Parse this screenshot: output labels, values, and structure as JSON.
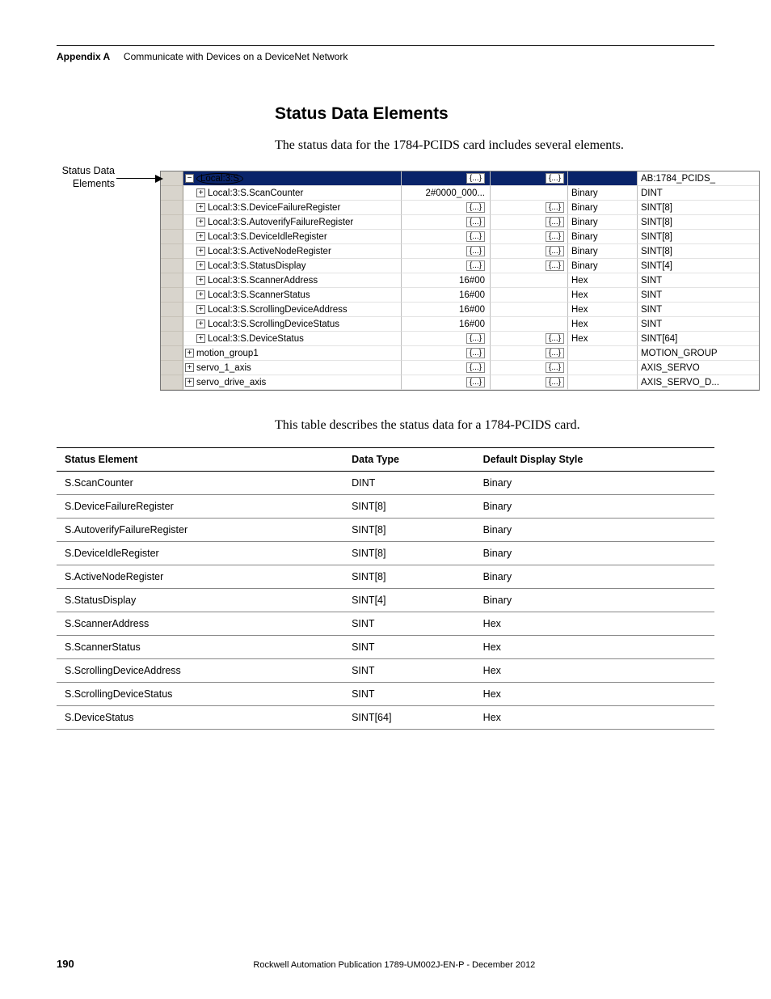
{
  "header": {
    "appendix": "Appendix A",
    "title": "Communicate with Devices on a DeviceNet Network"
  },
  "section": {
    "heading": "Status Data Elements",
    "intro": "The status data for the 1784-PCIDS card includes several elements.",
    "callout": "Status Data Elements",
    "desc": "This table describes the status data for a 1784-PCIDS card."
  },
  "screenshot_rows": [
    {
      "toggle": "−",
      "indent": 0,
      "name": "Local:3:S",
      "oval": true,
      "v1": "{...}",
      "v2": "{...}",
      "style": "",
      "type": "AB:1784_PCIDS_",
      "selected": true
    },
    {
      "toggle": "+",
      "indent": 1,
      "name": "Local:3:S.ScanCounter",
      "v1": "2#0000_000...",
      "v2": "",
      "style": "Binary",
      "type": "DINT"
    },
    {
      "toggle": "+",
      "indent": 1,
      "name": "Local:3:S.DeviceFailureRegister",
      "v1": "{...}",
      "v2": "{...}",
      "style": "Binary",
      "type": "SINT[8]"
    },
    {
      "toggle": "+",
      "indent": 1,
      "name": "Local:3:S.AutoverifyFailureRegister",
      "v1": "{...}",
      "v2": "{...}",
      "style": "Binary",
      "type": "SINT[8]"
    },
    {
      "toggle": "+",
      "indent": 1,
      "name": "Local:3:S.DeviceIdleRegister",
      "v1": "{...}",
      "v2": "{...}",
      "style": "Binary",
      "type": "SINT[8]"
    },
    {
      "toggle": "+",
      "indent": 1,
      "name": "Local:3:S.ActiveNodeRegister",
      "v1": "{...}",
      "v2": "{...}",
      "style": "Binary",
      "type": "SINT[8]"
    },
    {
      "toggle": "+",
      "indent": 1,
      "name": "Local:3:S.StatusDisplay",
      "v1": "{...}",
      "v2": "{...}",
      "style": "Binary",
      "type": "SINT[4]"
    },
    {
      "toggle": "+",
      "indent": 1,
      "name": "Local:3:S.ScannerAddress",
      "v1": "16#00",
      "v2": "",
      "style": "Hex",
      "type": "SINT"
    },
    {
      "toggle": "+",
      "indent": 1,
      "name": "Local:3:S.ScannerStatus",
      "v1": "16#00",
      "v2": "",
      "style": "Hex",
      "type": "SINT"
    },
    {
      "toggle": "+",
      "indent": 1,
      "name": "Local:3:S.ScrollingDeviceAddress",
      "v1": "16#00",
      "v2": "",
      "style": "Hex",
      "type": "SINT"
    },
    {
      "toggle": "+",
      "indent": 1,
      "name": "Local:3:S.ScrollingDeviceStatus",
      "v1": "16#00",
      "v2": "",
      "style": "Hex",
      "type": "SINT"
    },
    {
      "toggle": "+",
      "indent": 1,
      "name": "Local:3:S.DeviceStatus",
      "v1": "{...}",
      "v2": "{...}",
      "style": "Hex",
      "type": "SINT[64]"
    },
    {
      "toggle": "+",
      "indent": 0,
      "name": "motion_group1",
      "v1": "{...}",
      "v2": "{...}",
      "style": "",
      "type": "MOTION_GROUP"
    },
    {
      "toggle": "+",
      "indent": 0,
      "name": "servo_1_axis",
      "v1": "{...}",
      "v2": "{...}",
      "style": "",
      "type": "AXIS_SERVO"
    },
    {
      "toggle": "+",
      "indent": 0,
      "name": "servo_drive_axis",
      "v1": "{...}",
      "v2": "{...}",
      "style": "",
      "type": "AXIS_SERVO_D..."
    }
  ],
  "table": {
    "headers": [
      "Status Element",
      "Data Type",
      "Default Display Style"
    ],
    "rows": [
      [
        "S.ScanCounter",
        "DINT",
        "Binary"
      ],
      [
        "S.DeviceFailureRegister",
        "SINT[8]",
        "Binary"
      ],
      [
        "S.AutoverifyFailureRegister",
        "SINT[8]",
        "Binary"
      ],
      [
        "S.DeviceIdleRegister",
        "SINT[8]",
        "Binary"
      ],
      [
        "S.ActiveNodeRegister",
        "SINT[8]",
        "Binary"
      ],
      [
        "S.StatusDisplay",
        "SINT[4]",
        "Binary"
      ],
      [
        "S.ScannerAddress",
        "SINT",
        "Hex"
      ],
      [
        "S.ScannerStatus",
        "SINT",
        "Hex"
      ],
      [
        "S.ScrollingDeviceAddress",
        "SINT",
        "Hex"
      ],
      [
        "S.ScrollingDeviceStatus",
        "SINT",
        "Hex"
      ],
      [
        "S.DeviceStatus",
        "SINT[64]",
        "Hex"
      ]
    ]
  },
  "footer": {
    "page": "190",
    "pub": "Rockwell Automation Publication 1789-UM002J-EN-P - December 2012"
  }
}
